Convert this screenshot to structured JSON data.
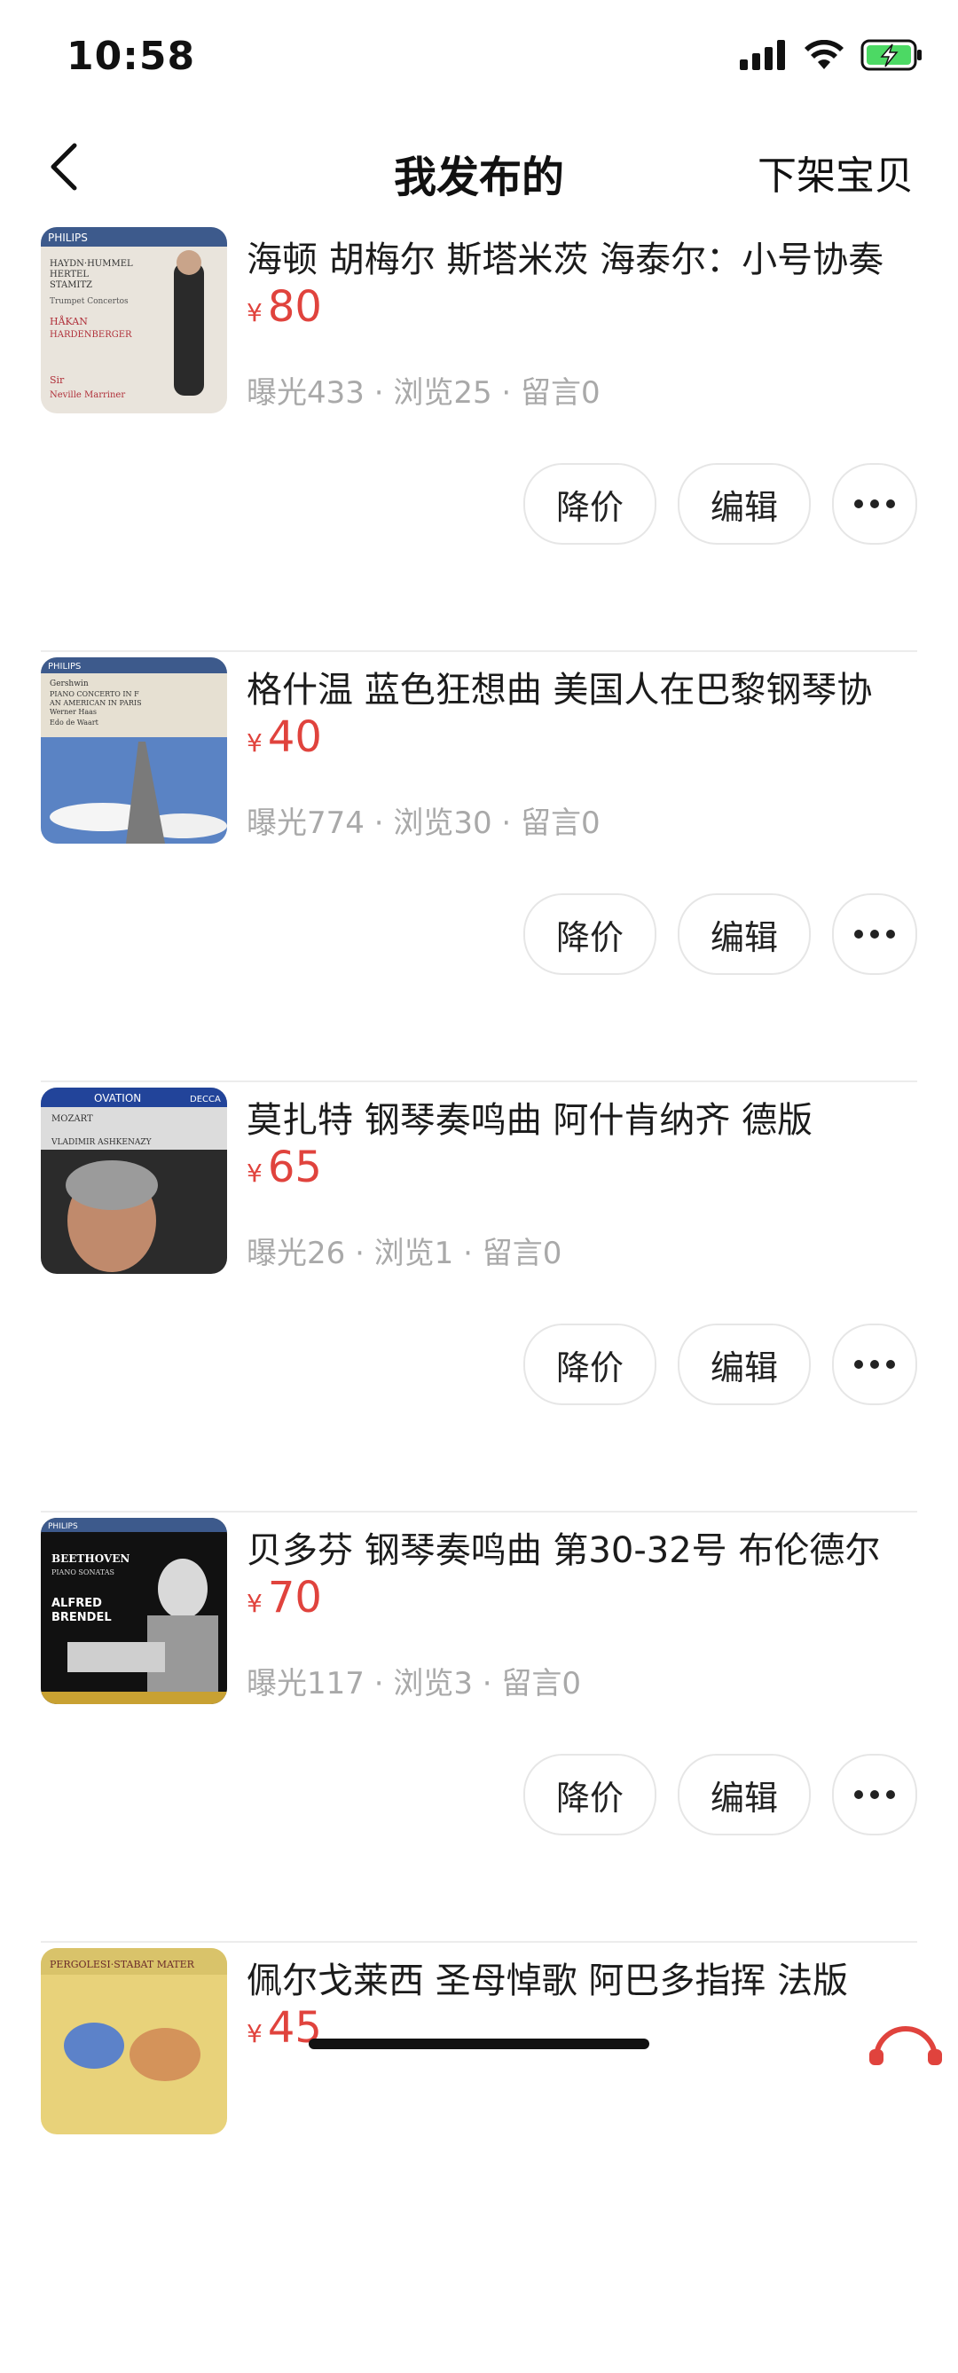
{
  "status": {
    "time": "10:58"
  },
  "nav": {
    "title": "我发布的",
    "action": "下架宝贝"
  },
  "items": [
    {
      "title": "海顿 胡梅尔 斯塔米茨 海泰尔：小号协奏",
      "currency": "¥",
      "price": "80",
      "stats": "曝光433 · 浏览25 · 留言0"
    },
    {
      "title": "格什温 蓝色狂想曲 美国人在巴黎钢琴协",
      "currency": "¥",
      "price": "40",
      "stats": "曝光774 · 浏览30 · 留言0"
    },
    {
      "title": "莫扎特 钢琴奏鸣曲 阿什肯纳齐 德版",
      "currency": "¥",
      "price": "65",
      "stats": "曝光26 · 浏览1 · 留言0"
    },
    {
      "title": "贝多芬 钢琴奏鸣曲 第30-32号 布伦德尔",
      "currency": "¥",
      "price": "70",
      "stats": "曝光117 · 浏览3 · 留言0"
    },
    {
      "title": "佩尔戈莱西 圣母悼歌 阿巴多指挥 法版",
      "currency": "¥",
      "price": "45",
      "stats": ""
    }
  ],
  "buttons": {
    "reduce": "降价",
    "edit": "编辑",
    "more": "•••"
  },
  "covers": [
    {
      "text": [
        "PHILIPS",
        "HAYDN·HUMMEL",
        "HERTEL",
        "STAMITZ",
        "Trumpet Concertos",
        "HÅKAN",
        "HARDENBERGER",
        "Sir",
        "Neville Marriner"
      ]
    },
    {
      "text": [
        "PHILIPS",
        "Gershwin",
        "PIANO CONCERTO IN F",
        "AN AMERICAN IN PARIS",
        "Werner Haas",
        "Edo de Waart"
      ]
    },
    {
      "text": [
        "OVATION",
        "DECCA",
        "MOZART",
        "VLADIMIR ASHKENAZY"
      ]
    },
    {
      "text": [
        "PHILIPS",
        "BEETHOVEN",
        "PIANO SONATAS",
        "ALFRED",
        "BRENDEL"
      ]
    },
    {
      "text": [
        "PERGOLESI·STABAT MATER"
      ]
    }
  ]
}
